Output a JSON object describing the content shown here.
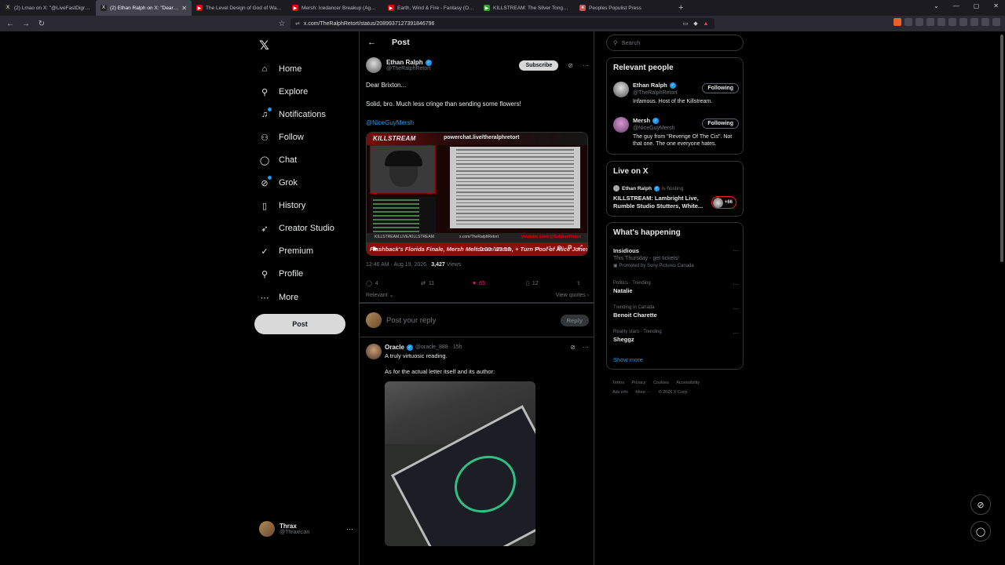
{
  "browser": {
    "tabs": [
      {
        "title": "(2) Lmao on X: \"@LiveFastDigress @",
        "fav": "X",
        "color": "#222"
      },
      {
        "title": "(2) Ethan Ralph on X: \"Dear Brixt",
        "fav": "X",
        "color": "#222",
        "active": true
      },
      {
        "title": "The Level Design of God of War - Yo",
        "fav": "▶",
        "color": "#e00"
      },
      {
        "title": "Mersh: Icedancer Breakup (Again), L",
        "fav": "▶",
        "color": "#e00"
      },
      {
        "title": "Earth, Wind & Fire - Fantasy (Official",
        "fav": "▶",
        "color": "#e00"
      },
      {
        "title": "KILLSTREAM: The Silver Tongued Do",
        "fav": "▶",
        "color": "#2a2"
      },
      {
        "title": "Peoples Populist Press",
        "fav": "●",
        "color": "#c55"
      }
    ],
    "url": "x.com/TheRalphRetort/status/2089937127391846796"
  },
  "sidebar": {
    "items": [
      {
        "label": "Home",
        "icon": "home-icon",
        "glyph": "⌂"
      },
      {
        "label": "Explore",
        "icon": "search-icon",
        "glyph": "⚲"
      },
      {
        "label": "Notifications",
        "icon": "bell-icon",
        "glyph": "♫"
      },
      {
        "label": "Follow",
        "icon": "follow-icon",
        "glyph": "⚇"
      },
      {
        "label": "Chat",
        "icon": "chat-icon",
        "glyph": "◯"
      },
      {
        "label": "Grok",
        "icon": "grok-icon",
        "glyph": "⊘"
      },
      {
        "label": "History",
        "icon": "bookmark-icon",
        "glyph": "▯"
      },
      {
        "label": "Creator Studio",
        "icon": "rocket-icon",
        "glyph": "➶"
      },
      {
        "label": "Premium",
        "icon": "premium-icon",
        "glyph": "✓"
      },
      {
        "label": "Profile",
        "icon": "profile-icon",
        "glyph": "⚲"
      },
      {
        "label": "More",
        "icon": "more-icon",
        "glyph": "⋯"
      }
    ],
    "post_label": "Post",
    "account": {
      "name": "Thrax",
      "handle": "@ThraxIcan"
    }
  },
  "header": {
    "title": "Post"
  },
  "post": {
    "author": "Ethan Ralph",
    "handle": "@TheRalphRetort",
    "subscribe_label": "Subscribe",
    "lines": [
      "Dear Brixton...",
      "Solid, bro. Much less cringe than sending some flowers!",
      "@NiceGuyMersh"
    ],
    "video": {
      "brand": "KILLSTREAM",
      "url": "powerchat.live/theralphretort",
      "url_left": "KILLSTREAM.LIVE/KILLSTREAM",
      "url_mid": "x.com/TheRalphRetort",
      "yt": "youtube.com/@SoldierVision",
      "ticker": "Flashback's Florida Finale, Mersh Meltdown Watch, + Turn Pool of Alice Jones",
      "time": "0:00 / 23:58"
    },
    "timestamp": "12:46 AM · Aug 19, 2026 · ",
    "views": "3,427",
    "views_label": " Views",
    "stats": {
      "replies": "4",
      "reposts": "11",
      "likes": "65",
      "bookmarks": "12"
    },
    "sort_label": "Relevant",
    "view_quotes": "View quotes"
  },
  "replybox": {
    "placeholder": "Post your reply",
    "button": "Reply"
  },
  "reply": {
    "author": "Oracle",
    "handle": "@oracle_888 · 15h",
    "line1": "A truly virtuosic reading.",
    "line2": "As for the actual letter itself and its author:"
  },
  "right": {
    "search_placeholder": "Search",
    "relevant_title": "Relevant people",
    "people": [
      {
        "name": "Ethan Ralph",
        "handle": "@TheRalphRetort",
        "bio": "Infamous. Host of the Killstream.",
        "button": "Following"
      },
      {
        "name": "Mersh",
        "handle": "@NiceGuyMersh",
        "bio": "The guy from \"Revenge Of The Cis\". Not that one. The one everyone hates.",
        "button": "Following"
      }
    ],
    "live_title": "Live on X",
    "live": {
      "host": "Ethan Ralph",
      "hosting": "is hosting",
      "title": "KILLSTREAM: Lambright Live, Rumble Studio Stutters, White...",
      "count": "+66"
    },
    "happening_title": "What's happening",
    "trends": [
      {
        "ctx": "",
        "name": "Insidious",
        "sub": "This Thursday - get tickets!",
        "promo": "Promoted by Sony Pictures Canada"
      },
      {
        "ctx": "Politics · Trending",
        "name": "Natalie",
        "sub": "",
        "promo": ""
      },
      {
        "ctx": "Trending in Canada",
        "name": "Benoit Charette",
        "sub": "",
        "promo": ""
      },
      {
        "ctx": "Reality stars · Trending",
        "name": "Sheggz",
        "sub": "",
        "promo": ""
      }
    ],
    "show_more": "Show more",
    "footer": [
      "Terms",
      "Privacy",
      "Cookies",
      "Accessibility",
      "Ads info",
      "More ···",
      "© 2026 X Corp."
    ]
  }
}
